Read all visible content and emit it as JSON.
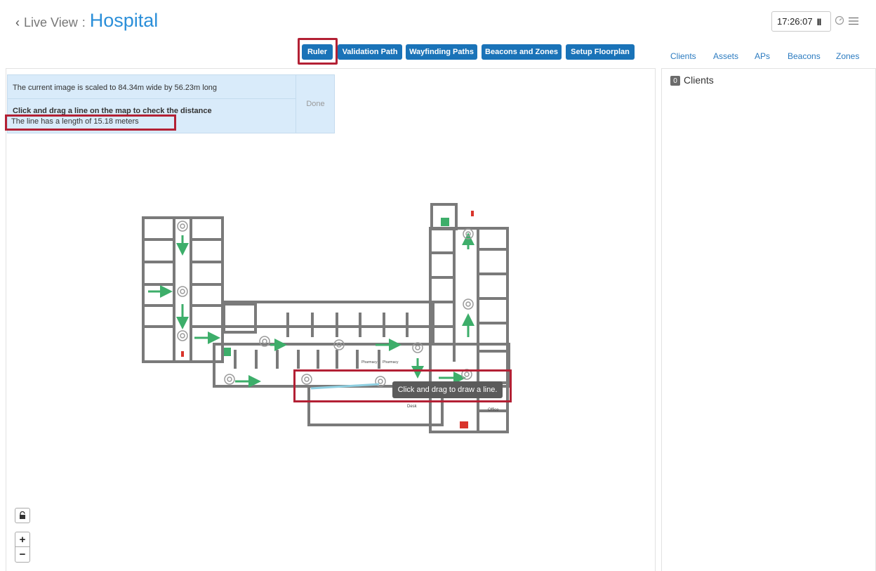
{
  "header": {
    "back_label": "Live View",
    "separator": ":",
    "location": "Hospital",
    "clock": "17:26:07",
    "pause_glyph": "II",
    "icons": [
      "chevron-left-icon",
      "pause-icon",
      "speed-icon",
      "menu-icon"
    ]
  },
  "toolbar": {
    "buttons": [
      {
        "label": "Ruler"
      },
      {
        "label": "Validation Path"
      },
      {
        "label": "Wayfinding Paths"
      },
      {
        "label": "Beacons and Zones"
      },
      {
        "label": "Setup Floorplan"
      }
    ],
    "accent": "#1a73b8"
  },
  "right_tabs": [
    "Clients",
    "Assets",
    "APs",
    "Beacons",
    "Zones"
  ],
  "info": {
    "scale_text": "The current image is scaled to 84.34m wide by 56.23m long",
    "instruction": "Click and drag a line on the map to check the distance",
    "length_text": "The line has a length of 15.18 meters",
    "done_label": "Done"
  },
  "map": {
    "tooltip": "Click and drag to draw a line.",
    "room_labels": {
      "pharmacy1": "Pharmacy",
      "pharmacy2": "Pharmacy",
      "desk": "Desk",
      "office": "Office"
    },
    "zoom_in": "+",
    "zoom_out": "−"
  },
  "clients": {
    "count": "0",
    "label": "Clients"
  },
  "colors": {
    "highlight": "#b32034",
    "title": "#2b8fd9",
    "info_bg": "#d9ebfa",
    "arrow_green": "#3dae6a",
    "wall": "#7a7a7a",
    "ruler_line": "#8fd0e2"
  }
}
